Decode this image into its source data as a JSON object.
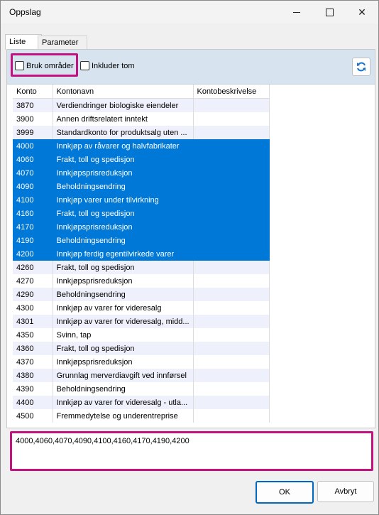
{
  "window": {
    "title": "Oppslag"
  },
  "tabs": [
    "Liste",
    "Parameter"
  ],
  "toolbar": {
    "bruk_omrader": "Bruk områder",
    "inkluder_tom": "Inkluder tom"
  },
  "table": {
    "headers": [
      "Konto",
      "Kontonavn",
      "Kontobeskrivelse"
    ],
    "rows": [
      {
        "konto": "3870",
        "navn": "Verdiendringer biologiske eiendeler",
        "state": "alt"
      },
      {
        "konto": "3900",
        "navn": "Annen driftsrelatert inntekt",
        "state": "norm"
      },
      {
        "konto": "3999",
        "navn": "Standardkonto for produktsalg uten ...",
        "state": "alt"
      },
      {
        "konto": "4000",
        "navn": "Innkjøp av råvarer og halvfabrikater",
        "state": "sel"
      },
      {
        "konto": "4060",
        "navn": "Frakt, toll og spedisjon",
        "state": "sel"
      },
      {
        "konto": "4070",
        "navn": "Innkjøpsprisreduksjon",
        "state": "sel"
      },
      {
        "konto": "4090",
        "navn": "Beholdningsendring",
        "state": "sel"
      },
      {
        "konto": "4100",
        "navn": "Innkjøp varer under tilvirkning",
        "state": "sel"
      },
      {
        "konto": "4160",
        "navn": "Frakt, toll og spedisjon",
        "state": "sel"
      },
      {
        "konto": "4170",
        "navn": "Innkjøpsprisreduksjon",
        "state": "sel"
      },
      {
        "konto": "4190",
        "navn": "Beholdningsendring",
        "state": "sel"
      },
      {
        "konto": "4200",
        "navn": "Innkjøp ferdig egentilvirkede varer",
        "state": "sel"
      },
      {
        "konto": "4260",
        "navn": "Frakt, toll og spedisjon",
        "state": "alt"
      },
      {
        "konto": "4270",
        "navn": "Innkjøpsprisreduksjon",
        "state": "norm"
      },
      {
        "konto": "4290",
        "navn": "Beholdningsendring",
        "state": "alt"
      },
      {
        "konto": "4300",
        "navn": "Innkjøp av varer for videresalg",
        "state": "norm"
      },
      {
        "konto": "4301",
        "navn": "Innkjøp av varer for videresalg, midd...",
        "state": "alt"
      },
      {
        "konto": "4350",
        "navn": "Svinn, tap",
        "state": "norm"
      },
      {
        "konto": "4360",
        "navn": "Frakt, toll og spedisjon",
        "state": "alt"
      },
      {
        "konto": "4370",
        "navn": "Innkjøpsprisreduksjon",
        "state": "norm"
      },
      {
        "konto": "4380",
        "navn": "Grunnlag merverdiavgift ved innførsel",
        "state": "alt"
      },
      {
        "konto": "4390",
        "navn": "Beholdningsendring",
        "state": "norm"
      },
      {
        "konto": "4400",
        "navn": "Innkjøp av varer for videresalg - utla...",
        "state": "alt"
      },
      {
        "konto": "4500",
        "navn": "Fremmedytelse og underentreprise",
        "state": "norm"
      }
    ]
  },
  "result": {
    "value": "4000,4060,4070,4090,4100,4160,4170,4190,4200"
  },
  "buttons": {
    "ok": "OK",
    "cancel": "Avbryt"
  }
}
